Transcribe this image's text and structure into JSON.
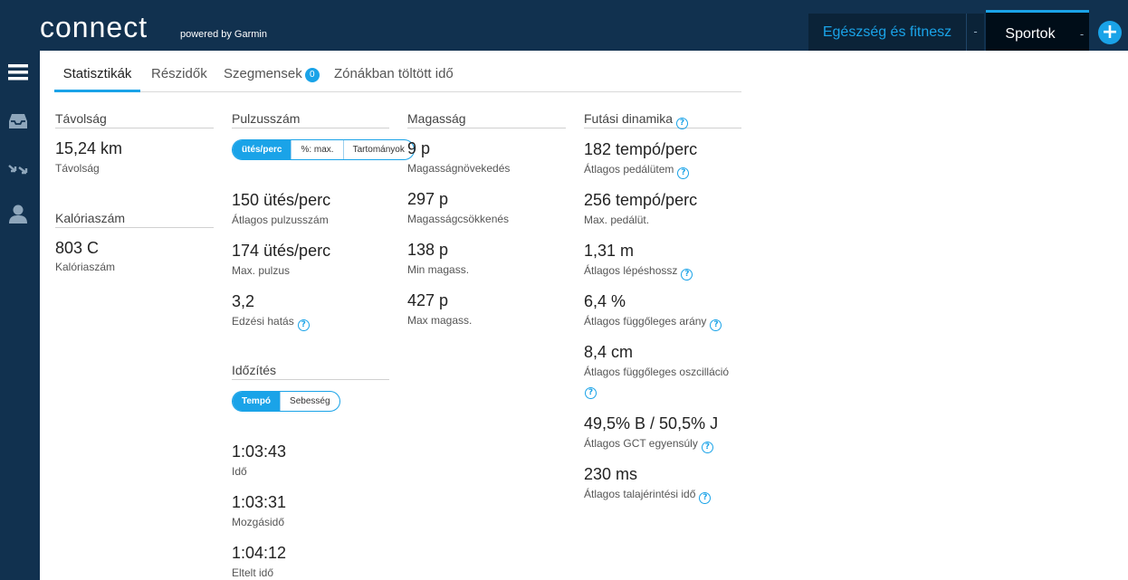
{
  "header": {
    "logo_text": "connect",
    "logo_sub": "powered by Garmin",
    "nav_health": "Egészség és fitnesz",
    "nav_sports": "Sportok",
    "nav_sep": "-",
    "plus_label": "+"
  },
  "tabs": {
    "stats": "Statisztikák",
    "splits": "Részidők",
    "segments": "Szegmensek",
    "segments_count": "0",
    "zones": "Zónákban töltött idő"
  },
  "distance": {
    "heading": "Távolság",
    "value": "15,24 km",
    "label": "Távolság"
  },
  "calories": {
    "heading": "Kalóriaszám",
    "value": "803 C",
    "label": "Kalóriaszám"
  },
  "heart_rate": {
    "heading": "Pulzusszám",
    "toggle": [
      "ütés/perc",
      "%: max.",
      "Tartományok"
    ],
    "avg_value": "150 ütés/perc",
    "avg_label": "Átlagos pulzusszám",
    "max_value": "174 ütés/perc",
    "max_label": "Max. pulzus",
    "te_value": "3,2",
    "te_label": "Edzési hatás"
  },
  "timing": {
    "heading": "Időzítés",
    "toggle": [
      "Tempó",
      "Sebesség"
    ],
    "time_value": "1:03:43",
    "time_label": "Idő",
    "moving_value": "1:03:31",
    "moving_label": "Mozgásidő",
    "elapsed_value": "1:04:12",
    "elapsed_label": "Eltelt idő"
  },
  "elevation": {
    "heading": "Magasság",
    "gain_value": "9 p",
    "gain_label": "Magasságnövekedés",
    "loss_value": "297 p",
    "loss_label": "Magasságcsökkenés",
    "min_value": "138 p",
    "min_label": "Min magass.",
    "max_value": "427 p",
    "max_label": "Max magass."
  },
  "dynamics": {
    "heading": "Futási dinamika",
    "cadence_avg_value": "182 tempó/perc",
    "cadence_avg_label": "Átlagos pedálütem",
    "cadence_max_value": "256 tempó/perc",
    "cadence_max_label": "Max. pedálüt.",
    "stride_value": "1,31 m",
    "stride_label": "Átlagos lépéshossz",
    "vratio_value": "6,4 %",
    "vratio_label": "Átlagos függőleges arány",
    "vosc_value": "8,4 cm",
    "vosc_label": "Átlagos függőleges oszcilláció",
    "gct_balance_value": "49,5% B / 50,5% J",
    "gct_balance_label": "Átlagos GCT egyensúly",
    "gct_value": "230 ms",
    "gct_label": "Átlagos talajérintési idő"
  },
  "icons": {
    "help": "?",
    "menu": "menu-icon",
    "inbox": "inbox-icon",
    "arrows": "arrows-icon",
    "user": "user-icon"
  },
  "colors": {
    "accent": "#1aa3e8",
    "navbar": "#11314f"
  }
}
